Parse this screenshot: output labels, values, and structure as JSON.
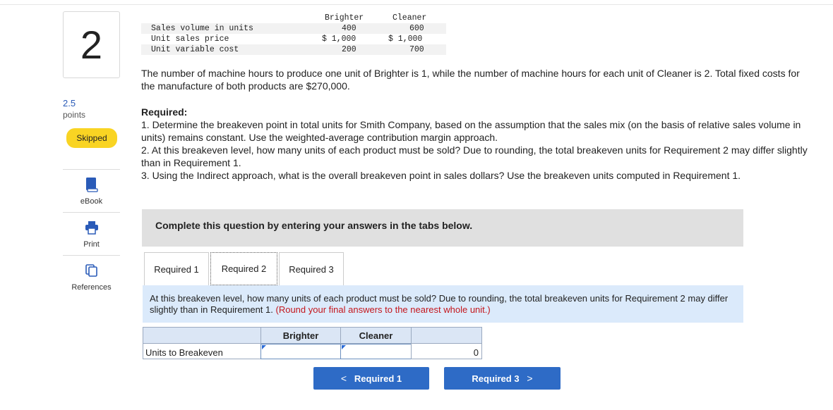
{
  "question": {
    "number": "2",
    "points_value": "2.5",
    "points_label": "points",
    "status": "Skipped"
  },
  "tools": [
    {
      "label": "eBook",
      "icon": "book-icon"
    },
    {
      "label": "Print",
      "icon": "printer-icon"
    },
    {
      "label": "References",
      "icon": "references-icon"
    }
  ],
  "data_table": {
    "headers": [
      "Brighter",
      "Cleaner"
    ],
    "rows": [
      {
        "label": "Sales volume in units",
        "brighter": "400",
        "cleaner": "600"
      },
      {
        "label": "Unit sales price",
        "brighter": "$ 1,000",
        "cleaner": "$ 1,000"
      },
      {
        "label": "Unit variable cost",
        "brighter": "200",
        "cleaner": "700"
      }
    ]
  },
  "description": "The number of machine hours to produce one unit of Brighter is 1, while the number of machine hours for each unit of Cleaner is 2. Total fixed costs for the manufacture of both products are $270,000.",
  "required": {
    "heading": "Required:",
    "items": [
      "1. Determine the breakeven point in total units for Smith Company, based on the assumption that the sales mix (on the basis of relative sales volume in units) remains constant. Use the weighted-average contribution margin approach.",
      "2. At this breakeven level, how many units of each product must be sold? Due to rounding, the total breakeven units for Requirement 2 may differ slightly than in Requirement 1.",
      "3. Using the Indirect approach, what is the overall breakeven point in sales dollars? Use the breakeven units computed in Requirement 1."
    ]
  },
  "banner": "Complete this question by entering your answers in the tabs below.",
  "tabs": [
    "Required 1",
    "Required 2",
    "Required 3"
  ],
  "active_tab": "Required 2",
  "instruction": {
    "text": "At this breakeven level, how many units of each product must be sold? Due to rounding, the total breakeven units for Requirement 2 may differ slightly than in Requirement 1.",
    "note": "(Round your final answers to the nearest whole unit.)"
  },
  "answer_table": {
    "headers": [
      "",
      "Brighter",
      "Cleaner",
      ""
    ],
    "row_label": "Units to Breakeven",
    "brighter_value": "",
    "cleaner_value": "",
    "total_value": "0"
  },
  "nav": {
    "prev_label": "Required 1",
    "next_label": "Required 3"
  },
  "colors": {
    "accent": "#2e6bc6",
    "skipped_badge": "#f9d423",
    "note_red": "#c4161c",
    "instruction_bg": "#dbeafb"
  }
}
